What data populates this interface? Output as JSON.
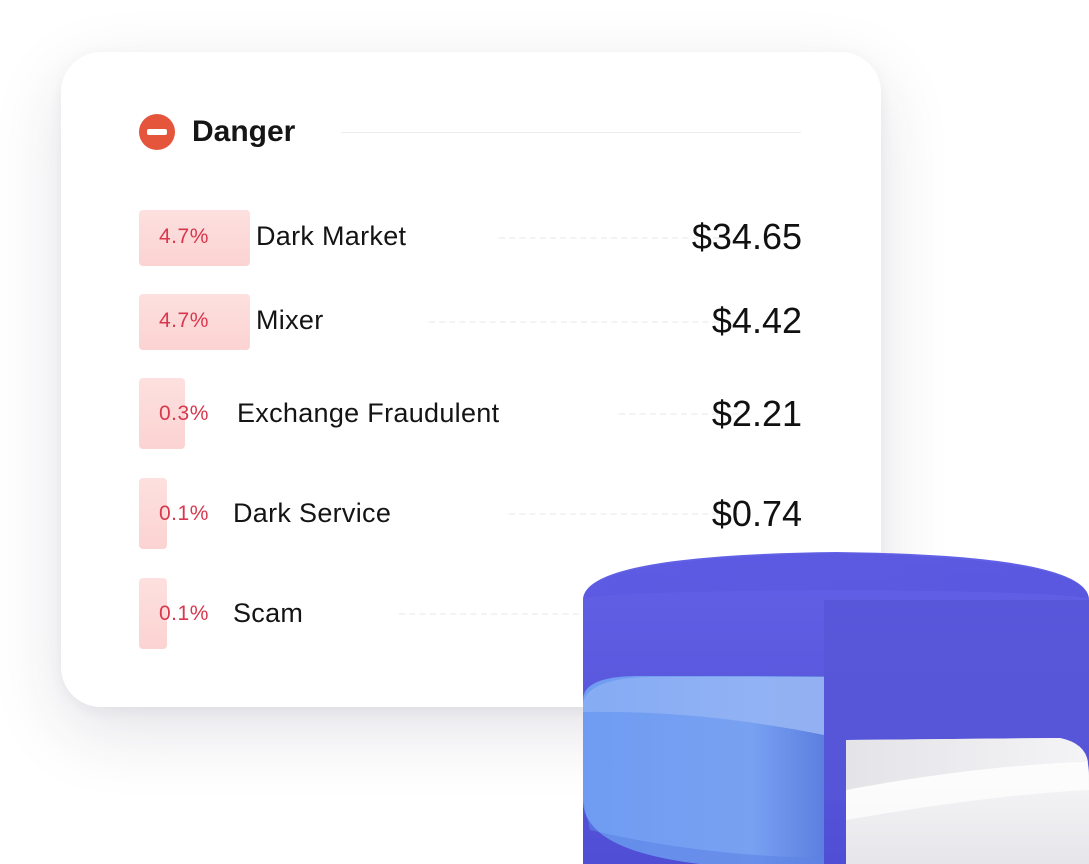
{
  "card": {
    "title": "Danger",
    "icon": "minus-circle-icon",
    "accent_color": "#e4553b",
    "rows": [
      {
        "percent": "4.7%",
        "label": "Dark Market",
        "value": "$34.65"
      },
      {
        "percent": "4.7%",
        "label": "Mixer",
        "value": "$4.42"
      },
      {
        "percent": "0.3%",
        "label": "Exchange Fraudulent",
        "value": "$2.21"
      },
      {
        "percent": "0.1%",
        "label": "Dark Service",
        "value": "$0.74"
      },
      {
        "percent": "0.1%",
        "label": "Scam",
        "value": ""
      }
    ]
  },
  "illustration": {
    "name": "pie-chart-3d-icon",
    "colors": {
      "large_slice": "#5f5ee4",
      "blue_slice": "#6f9bf2",
      "white_slice": "#f1f1f3"
    }
  }
}
